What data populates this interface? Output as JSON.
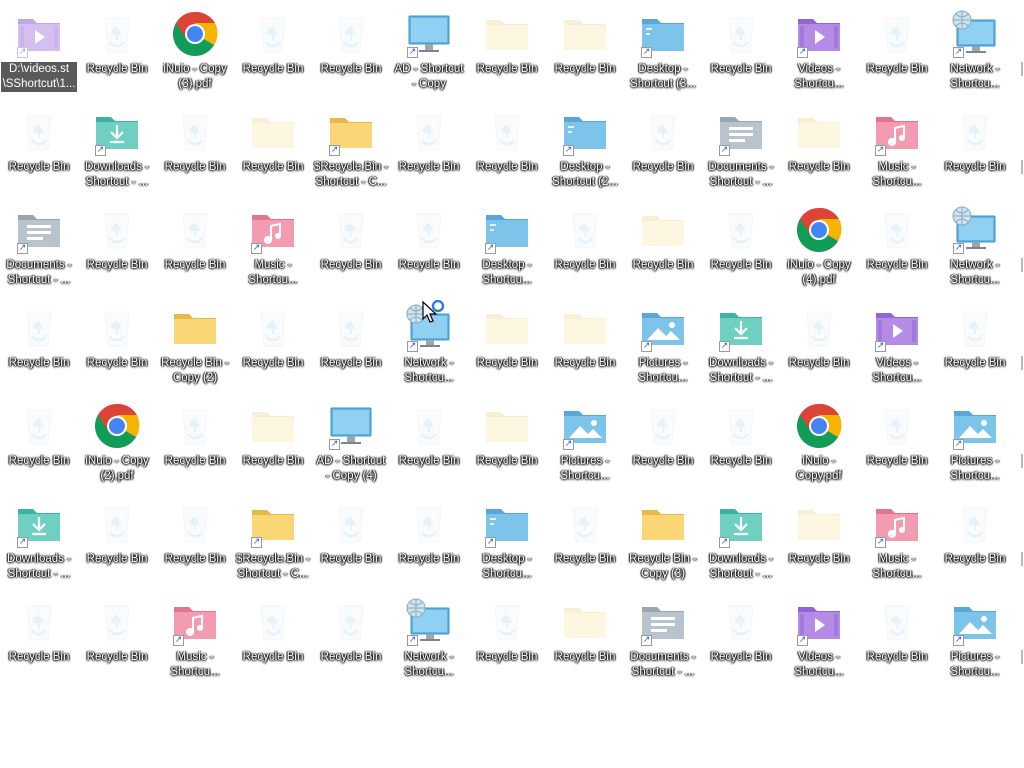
{
  "desktop": {
    "icons": [
      {
        "label": "D:\\videos.st \\SShortcut\\1...",
        "type": "videos",
        "shortcut": true,
        "style": "semi",
        "selected": true
      },
      {
        "label": "Recycle Bin",
        "type": "recycle",
        "shortcut": false,
        "style": "faded"
      },
      {
        "label": "iNuio - Copy (3).pdf",
        "type": "chrome",
        "shortcut": false,
        "style": "normal"
      },
      {
        "label": "Recycle Bin",
        "type": "recycle",
        "shortcut": false,
        "style": "faded"
      },
      {
        "label": "Recycle Bin",
        "type": "recycle",
        "shortcut": false,
        "style": "faded"
      },
      {
        "label": "AD - Shortcut - Copy",
        "type": "monitor",
        "shortcut": true,
        "style": "normal"
      },
      {
        "label": "Recycle Bin",
        "type": "folder",
        "shortcut": false,
        "style": "faded"
      },
      {
        "label": "Recycle Bin",
        "type": "folder",
        "shortcut": false,
        "style": "faded"
      },
      {
        "label": "Desktop - Shortcut (3...",
        "type": "desktopfolder",
        "shortcut": true,
        "style": "normal"
      },
      {
        "label": "Recycle Bin",
        "type": "recycle",
        "shortcut": false,
        "style": "faded"
      },
      {
        "label": "Videos - Shortcu...",
        "type": "videos",
        "shortcut": true,
        "style": "normal"
      },
      {
        "label": "Recycle Bin",
        "type": "recycle",
        "shortcut": false,
        "style": "faded"
      },
      {
        "label": "Network - Shortcu...",
        "type": "network",
        "shortcut": true,
        "style": "normal"
      },
      {
        "label": "Recycle Bin",
        "type": "recycle",
        "shortcut": false,
        "style": "faded"
      },
      {
        "label": "Downloads - Shortcut - ...",
        "type": "downloads",
        "shortcut": true,
        "style": "normal"
      },
      {
        "label": "Recycle Bin",
        "type": "recycle",
        "shortcut": false,
        "style": "faded"
      },
      {
        "label": "Recycle Bin",
        "type": "folder",
        "shortcut": false,
        "style": "faded"
      },
      {
        "label": "$Recycle.Bin - Shortcut - C...",
        "type": "folder",
        "shortcut": true,
        "style": "normal"
      },
      {
        "label": "Recycle Bin",
        "type": "recycle",
        "shortcut": false,
        "style": "faded"
      },
      {
        "label": "Recycle Bin",
        "type": "recycle",
        "shortcut": false,
        "style": "faded"
      },
      {
        "label": "Desktop - Shortcut (2...",
        "type": "desktopfolder",
        "shortcut": true,
        "style": "normal"
      },
      {
        "label": "Recycle Bin",
        "type": "recycle",
        "shortcut": false,
        "style": "faded"
      },
      {
        "label": "Documents - Shortcut - ...",
        "type": "documents",
        "shortcut": true,
        "style": "normal"
      },
      {
        "label": "Recycle Bin",
        "type": "folder",
        "shortcut": false,
        "style": "faded"
      },
      {
        "label": "Music - Shortcu...",
        "type": "music",
        "shortcut": true,
        "style": "normal"
      },
      {
        "label": "Recycle Bin",
        "type": "recycle",
        "shortcut": false,
        "style": "faded"
      },
      {
        "label": "Documents - Shortcut - ...",
        "type": "documents",
        "shortcut": true,
        "style": "normal"
      },
      {
        "label": "Recycle Bin",
        "type": "recycle",
        "shortcut": false,
        "style": "faded"
      },
      {
        "label": "Recycle Bin",
        "type": "recycle",
        "shortcut": false,
        "style": "faded"
      },
      {
        "label": "Music - Shortcu...",
        "type": "music",
        "shortcut": true,
        "style": "normal"
      },
      {
        "label": "Recycle Bin",
        "type": "recycle",
        "shortcut": false,
        "style": "faded"
      },
      {
        "label": "Recycle Bin",
        "type": "recycle",
        "shortcut": false,
        "style": "faded"
      },
      {
        "label": "Desktop - Shortcu...",
        "type": "desktopfolder",
        "shortcut": true,
        "style": "normal"
      },
      {
        "label": "Recycle Bin",
        "type": "recycle",
        "shortcut": false,
        "style": "faded"
      },
      {
        "label": "Recycle Bin",
        "type": "folder",
        "shortcut": false,
        "style": "faded"
      },
      {
        "label": "Recycle Bin",
        "type": "recycle",
        "shortcut": false,
        "style": "faded"
      },
      {
        "label": "iNuio - Copy (4).pdf",
        "type": "chrome",
        "shortcut": false,
        "style": "normal"
      },
      {
        "label": "Recycle Bin",
        "type": "recycle",
        "shortcut": false,
        "style": "faded"
      },
      {
        "label": "Network - Shortcu...",
        "type": "network",
        "shortcut": true,
        "style": "normal"
      },
      {
        "label": "Recycle Bin",
        "type": "recycle",
        "shortcut": false,
        "style": "faded"
      },
      {
        "label": "Recycle Bin",
        "type": "recycle",
        "shortcut": false,
        "style": "faded"
      },
      {
        "label": "Recycle Bin - Copy (2)",
        "type": "folder",
        "shortcut": false,
        "style": "normal"
      },
      {
        "label": "Recycle Bin",
        "type": "recycle",
        "shortcut": false,
        "style": "faded"
      },
      {
        "label": "Recycle Bin",
        "type": "recycle",
        "shortcut": false,
        "style": "faded"
      },
      {
        "label": "Network - Shortcu...",
        "type": "network",
        "shortcut": true,
        "style": "normal"
      },
      {
        "label": "Recycle Bin",
        "type": "folder",
        "shortcut": false,
        "style": "faded"
      },
      {
        "label": "Recycle Bin",
        "type": "folder",
        "shortcut": false,
        "style": "faded"
      },
      {
        "label": "Pictures - Shortcu...",
        "type": "pictures",
        "shortcut": true,
        "style": "normal"
      },
      {
        "label": "Downloads - Shortcut - ...",
        "type": "downloads",
        "shortcut": true,
        "style": "normal"
      },
      {
        "label": "Recycle Bin",
        "type": "recycle",
        "shortcut": false,
        "style": "faded"
      },
      {
        "label": "Videos - Shortcu...",
        "type": "videos",
        "shortcut": true,
        "style": "normal"
      },
      {
        "label": "Recycle Bin",
        "type": "recycle",
        "shortcut": false,
        "style": "faded"
      },
      {
        "label": "Recycle Bin",
        "type": "recycle",
        "shortcut": false,
        "style": "faded"
      },
      {
        "label": "iNuio - Copy (2).pdf",
        "type": "chrome",
        "shortcut": false,
        "style": "normal"
      },
      {
        "label": "Recycle Bin",
        "type": "recycle",
        "shortcut": false,
        "style": "faded"
      },
      {
        "label": "Recycle Bin",
        "type": "folder",
        "shortcut": false,
        "style": "faded"
      },
      {
        "label": "AD - Shortcut - Copy (4)",
        "type": "monitor",
        "shortcut": true,
        "style": "normal"
      },
      {
        "label": "Recycle Bin",
        "type": "recycle",
        "shortcut": false,
        "style": "faded"
      },
      {
        "label": "Recycle Bin",
        "type": "folder",
        "shortcut": false,
        "style": "faded"
      },
      {
        "label": "Pictures - Shortcu...",
        "type": "pictures",
        "shortcut": true,
        "style": "normal"
      },
      {
        "label": "Recycle Bin",
        "type": "recycle",
        "shortcut": false,
        "style": "faded"
      },
      {
        "label": "Recycle Bin",
        "type": "recycle",
        "shortcut": false,
        "style": "faded"
      },
      {
        "label": "iNuio - Copy.pdf",
        "type": "chrome",
        "shortcut": false,
        "style": "normal"
      },
      {
        "label": "Recycle Bin",
        "type": "recycle",
        "shortcut": false,
        "style": "faded"
      },
      {
        "label": "Pictures - Shortcu...",
        "type": "pictures",
        "shortcut": true,
        "style": "normal"
      },
      {
        "label": "Downloads - Shortcut - ...",
        "type": "downloads",
        "shortcut": true,
        "style": "normal"
      },
      {
        "label": "Recycle Bin",
        "type": "recycle",
        "shortcut": false,
        "style": "faded"
      },
      {
        "label": "Recycle Bin",
        "type": "recycle",
        "shortcut": false,
        "style": "faded"
      },
      {
        "label": "$Recycle.Bin - Shortcut - C...",
        "type": "folder",
        "shortcut": true,
        "style": "normal"
      },
      {
        "label": "Recycle Bin",
        "type": "recycle",
        "shortcut": false,
        "style": "faded"
      },
      {
        "label": "Recycle Bin",
        "type": "recycle",
        "shortcut": false,
        "style": "faded"
      },
      {
        "label": "Desktop - Shortcu...",
        "type": "desktopfolder",
        "shortcut": true,
        "style": "normal"
      },
      {
        "label": "Recycle Bin",
        "type": "recycle",
        "shortcut": false,
        "style": "faded"
      },
      {
        "label": "Recycle Bin - Copy (3)",
        "type": "folder",
        "shortcut": false,
        "style": "normal"
      },
      {
        "label": "Downloads - Shortcut - ...",
        "type": "downloads",
        "shortcut": true,
        "style": "normal"
      },
      {
        "label": "Recycle Bin",
        "type": "folder",
        "shortcut": false,
        "style": "faded"
      },
      {
        "label": "Music - Shortcu...",
        "type": "music",
        "shortcut": true,
        "style": "normal"
      },
      {
        "label": "Recycle Bin",
        "type": "recycle",
        "shortcut": false,
        "style": "faded"
      },
      {
        "label": "Recycle Bin",
        "type": "recycle",
        "shortcut": false,
        "style": "faded"
      },
      {
        "label": "Recycle Bin",
        "type": "recycle",
        "shortcut": false,
        "style": "faded"
      },
      {
        "label": "Music - Shortcu...",
        "type": "music",
        "shortcut": true,
        "style": "normal"
      },
      {
        "label": "Recycle Bin",
        "type": "recycle",
        "shortcut": false,
        "style": "faded"
      },
      {
        "label": "Recycle Bin",
        "type": "recycle",
        "shortcut": false,
        "style": "faded"
      },
      {
        "label": "Network - Shortcu...",
        "type": "network",
        "shortcut": true,
        "style": "normal"
      },
      {
        "label": "Recycle Bin",
        "type": "recycle",
        "shortcut": false,
        "style": "faded"
      },
      {
        "label": "Recycle Bin",
        "type": "folder",
        "shortcut": false,
        "style": "faded"
      },
      {
        "label": "Documents - Shortcut - ...",
        "type": "documents",
        "shortcut": true,
        "style": "normal"
      },
      {
        "label": "Recycle Bin",
        "type": "recycle",
        "shortcut": false,
        "style": "faded"
      },
      {
        "label": "Videos - Shortcu...",
        "type": "videos",
        "shortcut": true,
        "style": "normal"
      },
      {
        "label": "Recycle Bin",
        "type": "recycle",
        "shortcut": false,
        "style": "faded"
      },
      {
        "label": "Pictures - Shortcu...",
        "type": "pictures",
        "shortcut": true,
        "style": "normal"
      }
    ]
  },
  "colors": {
    "background": "#ffffff",
    "folder": "#f9d776",
    "folder_dark": "#e8b94a",
    "blue_folder": "#7cc4ea",
    "teal_folder": "#6fd0c2",
    "purple_folder": "#b48be6",
    "pink_folder": "#f39bb0",
    "grey_folder": "#b9c3cd",
    "monitor": "#5fb5e5",
    "recycle": "#8fc5e8",
    "label_text": "#ffffff",
    "selection": "#5a5a5a"
  }
}
